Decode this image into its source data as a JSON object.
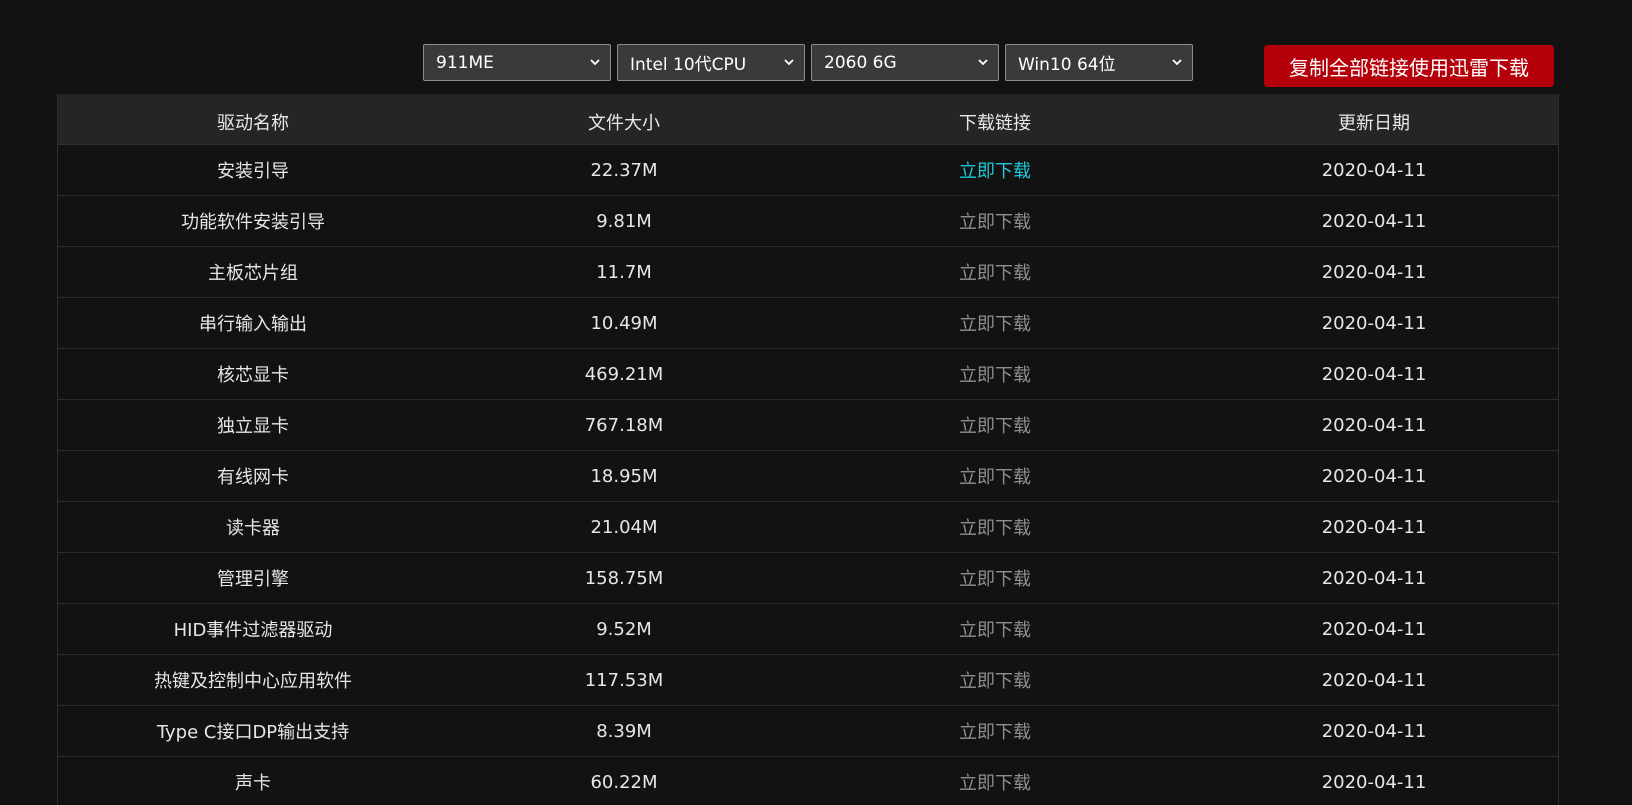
{
  "filters": [
    {
      "value": "911ME"
    },
    {
      "value": "Intel 10代CPU"
    },
    {
      "value": "2060 6G"
    },
    {
      "value": "Win10 64位"
    }
  ],
  "copy_button": "复制全部链接使用迅雷下载",
  "table": {
    "headers": [
      "驱动名称",
      "文件大小",
      "下载链接",
      "更新日期"
    ],
    "rows": [
      {
        "name": "安装引导",
        "size": "22.37M",
        "link": "立即下载",
        "date": "2020-04-11"
      },
      {
        "name": "功能软件安装引导",
        "size": "9.81M",
        "link": "立即下载",
        "date": "2020-04-11"
      },
      {
        "name": "主板芯片组",
        "size": "11.7M",
        "link": "立即下载",
        "date": "2020-04-11"
      },
      {
        "name": "串行输入输出",
        "size": "10.49M",
        "link": "立即下载",
        "date": "2020-04-11"
      },
      {
        "name": "核芯显卡",
        "size": "469.21M",
        "link": "立即下载",
        "date": "2020-04-11"
      },
      {
        "name": "独立显卡",
        "size": "767.18M",
        "link": "立即下载",
        "date": "2020-04-11"
      },
      {
        "name": "有线网卡",
        "size": "18.95M",
        "link": "立即下载",
        "date": "2020-04-11"
      },
      {
        "name": "读卡器",
        "size": "21.04M",
        "link": "立即下载",
        "date": "2020-04-11"
      },
      {
        "name": "管理引擎",
        "size": "158.75M",
        "link": "立即下载",
        "date": "2020-04-11"
      },
      {
        "name": "HID事件过滤器驱动",
        "size": "9.52M",
        "link": "立即下载",
        "date": "2020-04-11"
      },
      {
        "name": "热键及控制中心应用软件",
        "size": "117.53M",
        "link": "立即下载",
        "date": "2020-04-11"
      },
      {
        "name": "Type C接口DP输出支持",
        "size": "8.39M",
        "link": "立即下载",
        "date": "2020-04-11"
      },
      {
        "name": "声卡",
        "size": "60.22M",
        "link": "立即下载",
        "date": "2020-04-11"
      }
    ]
  },
  "colors": {
    "background": "#121212",
    "header_bg": "#252525",
    "button_red": "#b5000c",
    "link_active": "#1ec8d6",
    "link_normal": "#8e8e8e"
  },
  "icons": {
    "select_arrow": "chevron-down-icon"
  }
}
